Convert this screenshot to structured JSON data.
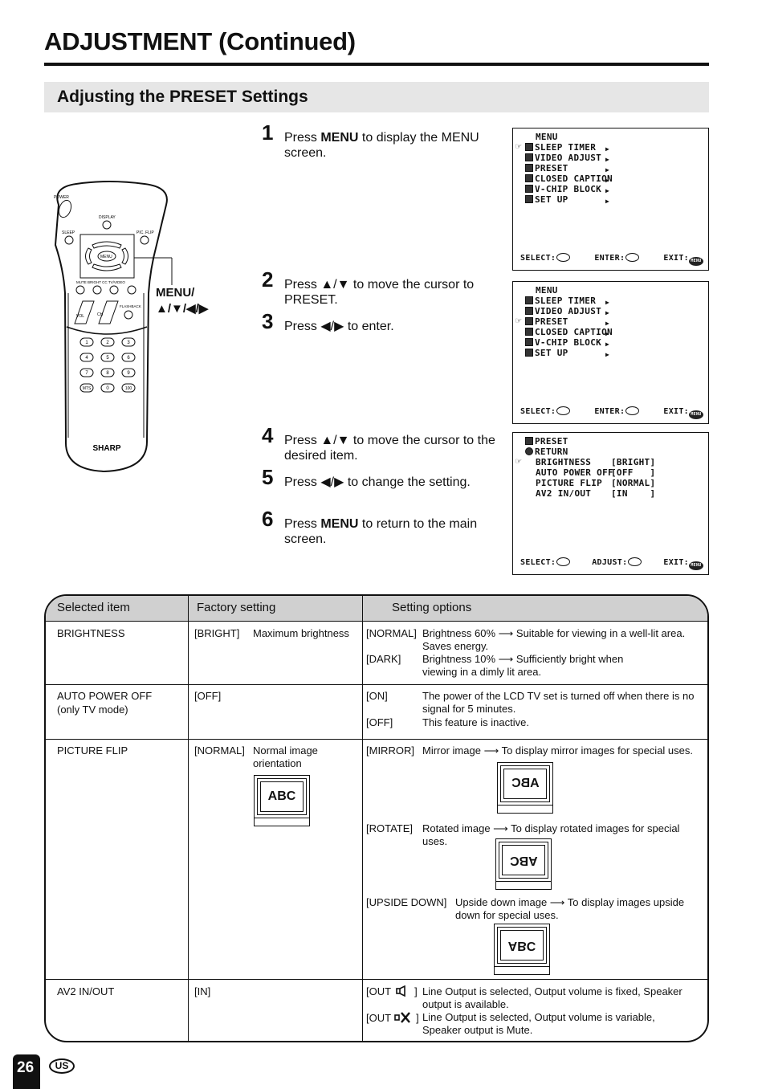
{
  "page": {
    "title": "ADJUSTMENT (Continued)",
    "section_title": "Adjusting the PRESET Settings",
    "page_number": "26",
    "region": "US"
  },
  "remote": {
    "brand": "SHARP",
    "buttons": [
      "POWER",
      "DISPLAY",
      "SLEEP",
      "PIC. FLIP",
      "MENU",
      "MUTE",
      "BRIGHT",
      "CC",
      "TV/VIDEO",
      "VOL",
      "CH",
      "FLASHBACK",
      "1",
      "2",
      "3",
      "4",
      "5",
      "6",
      "7",
      "8",
      "9",
      "MTS",
      "0",
      "100"
    ],
    "callout_line1": "MENU/",
    "callout_line2": "▲/▼/◀/▶"
  },
  "steps": [
    {
      "num": "1",
      "pre": "Press ",
      "bold": "MENU",
      "post": " to display the MENU screen."
    },
    {
      "num": "2",
      "pre": "Press ▲/▼ to move the cursor to PRESET.",
      "bold": "",
      "post": ""
    },
    {
      "num": "3",
      "pre": "Press ◀/▶ to enter.",
      "bold": "",
      "post": ""
    },
    {
      "num": "4",
      "pre": "Press ▲/▼ to move the cursor to the desired item.",
      "bold": "",
      "post": ""
    },
    {
      "num": "5",
      "pre": "Press ◀/▶ to change the setting.",
      "bold": "",
      "post": ""
    },
    {
      "num": "6",
      "pre": "Press ",
      "bold": "MENU",
      "post": " to return to the main screen."
    }
  ],
  "osd_menu": {
    "title": "MENU",
    "items": [
      "SLEEP TIMER",
      "VIDEO ADJUST",
      "PRESET",
      "CLOSED CAPTION",
      "V-CHIP BLOCK",
      "SET UP"
    ],
    "footer_select": "SELECT:",
    "footer_enter": "ENTER:",
    "footer_exit": "EXIT:",
    "menu_btn": "MENU"
  },
  "osd_preset": {
    "title": "PRESET",
    "return": "RETURN",
    "rows": [
      {
        "label": "BRIGHTNESS",
        "value": "[BRIGHT]"
      },
      {
        "label": "AUTO POWER OFF",
        "value": "[OFF   ]"
      },
      {
        "label": "PICTURE FLIP",
        "value": "[NORMAL]"
      },
      {
        "label": "AV2 IN/OUT",
        "value": "[IN    ]"
      }
    ],
    "footer_select": "SELECT:",
    "footer_adjust": "ADJUST:",
    "footer_exit": "EXIT:"
  },
  "table": {
    "headers": [
      "Selected item",
      "Factory setting",
      "Setting options"
    ],
    "rows": [
      {
        "item": "BRIGHTNESS",
        "item_sub": "",
        "factory_key": "[BRIGHT]",
        "factory_desc": "Maximum brightness",
        "options": [
          {
            "key": "[NORMAL]",
            "desc": "Brightness 60% ⟶ Suitable for viewing in a well-lit area. Saves energy."
          },
          {
            "key": "[DARK]",
            "desc": "Brightness 10% ⟶ Sufficiently bright when viewing in a dimly lit area."
          }
        ]
      },
      {
        "item": "AUTO POWER OFF",
        "item_sub": "(only TV mode)",
        "factory_key": "[OFF]",
        "factory_desc": "",
        "options": [
          {
            "key": "[ON]",
            "desc": "The power of the LCD TV set is turned off when there is no signal for 5 minutes."
          },
          {
            "key": "[OFF]",
            "desc": "This feature is inactive."
          }
        ]
      },
      {
        "item": "PICTURE FLIP",
        "item_sub": "",
        "factory_key": "[NORMAL]",
        "factory_desc": "Normal image orientation",
        "factory_image": "ABC",
        "options": [
          {
            "key": "[MIRROR]",
            "desc": "Mirror image ⟶ To display mirror images for special uses.",
            "image": "ABC"
          },
          {
            "key": "[ROTATE]",
            "desc": "Rotated image ⟶ To display rotated images for special uses.",
            "image": "ABC"
          },
          {
            "key": "[UPSIDE DOWN]",
            "desc": "Upside down image ⟶ To display images upside down for special uses.",
            "image": "ABC"
          }
        ]
      },
      {
        "item": "AV2 IN/OUT",
        "item_sub": "",
        "factory_key": "[IN]",
        "factory_desc": "",
        "options": [
          {
            "key": "[OUT",
            "icon": "speaker-icon",
            "key_end": "]",
            "desc": "Line Output is selected, Output volume is fixed, Speaker output is available."
          },
          {
            "key": "[OUT",
            "icon": "speaker-mute-icon",
            "key_end": "]",
            "desc": "Line Output is selected, Output volume is variable, Speaker output is Mute."
          }
        ]
      }
    ]
  }
}
